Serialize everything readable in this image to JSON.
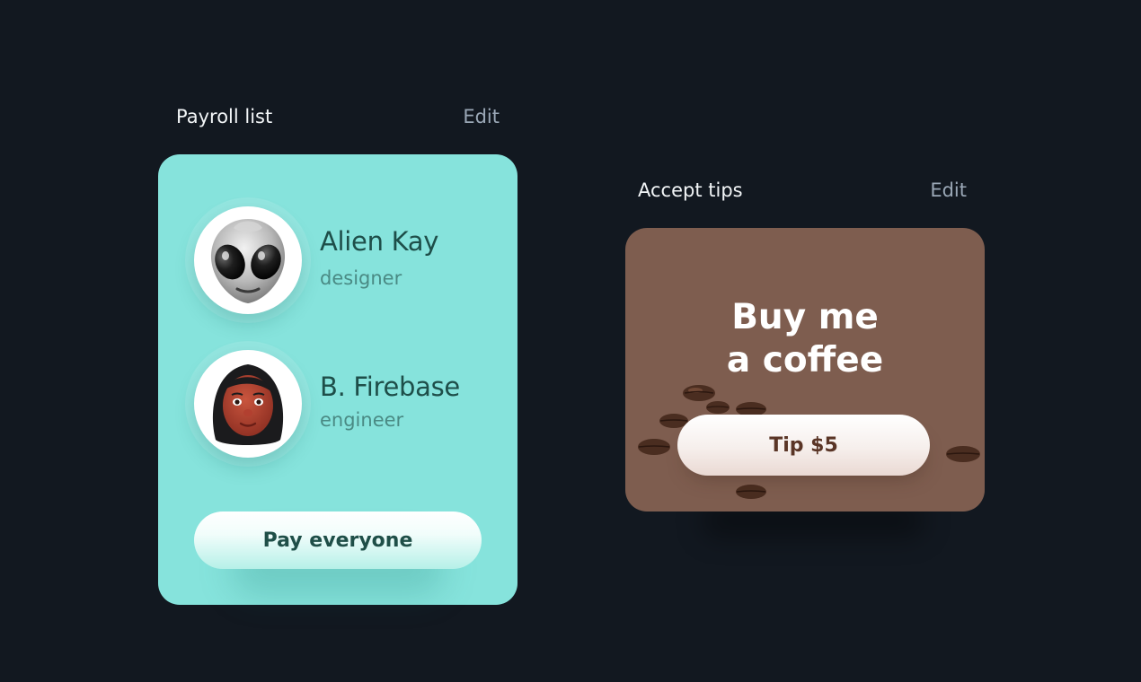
{
  "payroll": {
    "title": "Payroll list",
    "edit_label": "Edit",
    "people": [
      {
        "name": "Alien Kay",
        "role": "designer",
        "avatar": "alien-avatar-icon"
      },
      {
        "name": "B. Firebase",
        "role": "engineer",
        "avatar": "woman-avatar-icon"
      }
    ],
    "pay_button_label": "Pay everyone",
    "card_color": "#86e3dc"
  },
  "tips": {
    "title": "Accept tips",
    "edit_label": "Edit",
    "headline_line1": "Buy me",
    "headline_line2": "a coffee",
    "tip_button_label": "Tip $5",
    "card_color": "#7e5d4f"
  }
}
